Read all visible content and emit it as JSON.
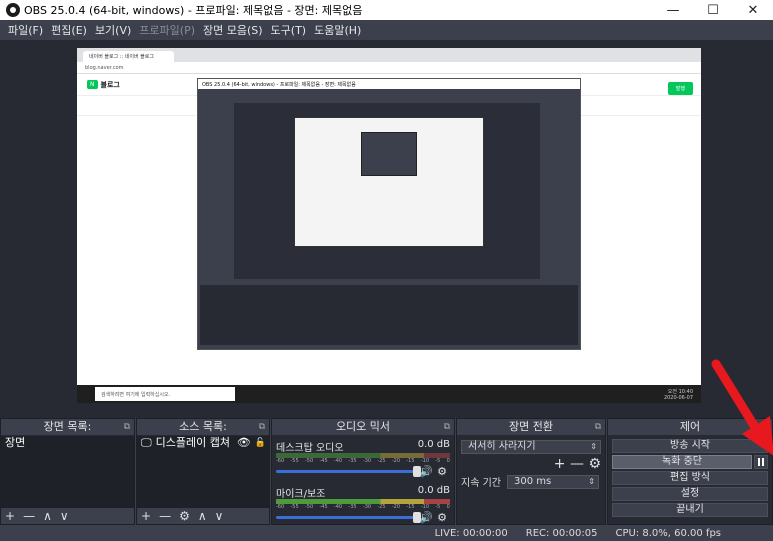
{
  "window": {
    "title": "OBS 25.0.4 (64-bit, windows) - 프로파일: 제목없음 - 장면: 제목없음",
    "minimize": "—",
    "maximize": "☐",
    "close": "✕"
  },
  "menu": [
    "파일(F)",
    "편집(E)",
    "보기(V)",
    "프로파일(P)",
    "장면 모음(S)",
    "도구(T)",
    "도움말(H)"
  ],
  "preview": {
    "tab_label": "네이버 블로그 :: 네이버 블로그",
    "url": "blog.naver.com",
    "blog_name": "블로그",
    "blog_logo": "N",
    "publish": "발행",
    "nested_title": "OBS 25.0.4 (64-bit, windows) - 프로파일: 제목없음 - 장면: 제목없음",
    "taskbar_search": "검색하려면 여기에 입력하십시오.",
    "taskbar_time": "오전 10:40",
    "taskbar_date": "2020-06-07"
  },
  "docks": {
    "scenes": {
      "title": "장면 목록:",
      "items": [
        "장면"
      ],
      "footer": [
        "+",
        "—",
        "∧",
        "∨"
      ]
    },
    "sources": {
      "title": "소스 목록:",
      "items": [
        {
          "label": "디스플레이 캡쳐",
          "icon": "monitor-icon"
        }
      ],
      "footer": [
        "+",
        "—",
        "⚙",
        "∧",
        "∨"
      ]
    },
    "mixer": {
      "title": "오디오 믹서",
      "channels": [
        {
          "name": "데스크탑 오디오",
          "db": "0.0 dB"
        },
        {
          "name": "마이크/보조",
          "db": "0.0 dB"
        }
      ],
      "ticks": [
        "-60",
        "-55",
        "-50",
        "-45",
        "-40",
        "-35",
        "-30",
        "-25",
        "-20",
        "-15",
        "-10",
        "-5",
        "0"
      ]
    },
    "transitions": {
      "title": "장면 전환",
      "selected": "서서히 사라지기",
      "duration_label": "지속 기간",
      "duration_value": "300 ms"
    },
    "controls": {
      "title": "제어",
      "buttons": {
        "start_stream": "방송 시작",
        "stop_record": "녹화 중단",
        "studio_mode": "편집 방식",
        "settings": "설정",
        "exit": "끝내기"
      }
    }
  },
  "status": {
    "live": "LIVE: 00:00:00",
    "rec": "REC: 00:00:05",
    "cpu": "CPU: 8.0%, 60.00 fps"
  },
  "colors": {
    "background": "#2b2e38",
    "dock": "#272a33",
    "panel": "#3c404d",
    "accent": "#3b6fd8",
    "annotation_arrow": "#e8181f"
  }
}
